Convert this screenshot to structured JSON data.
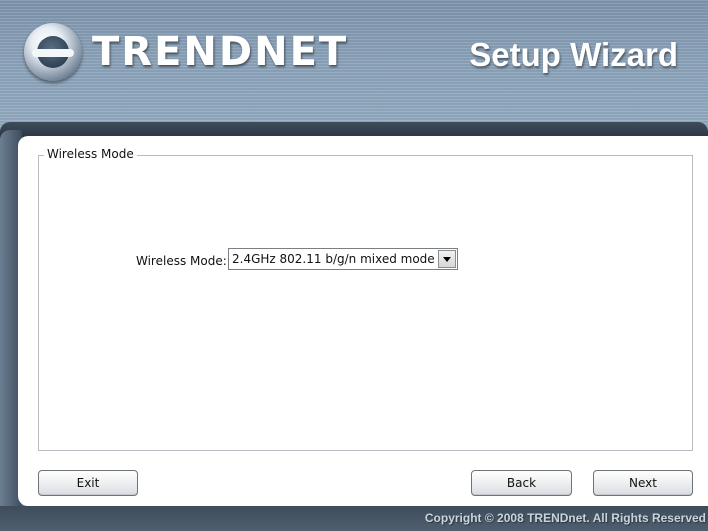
{
  "header": {
    "brand": "TRENDNET",
    "title": "Setup Wizard",
    "logo_icon": "trendnet-globe-logo-icon"
  },
  "section": {
    "legend": "Wireless Mode",
    "wireless_mode_label": "Wireless Mode:",
    "wireless_mode_value": "2.4GHz 802.11 b/g/n mixed mode",
    "dropdown_icon": "chevron-down-icon"
  },
  "buttons": {
    "exit": "Exit",
    "back": "Back",
    "next": "Next"
  },
  "footer": {
    "copyright": "Copyright © 2008 TRENDnet. All Rights Reserved"
  },
  "colors": {
    "header": "#8aa2b9",
    "band": "#2a3642",
    "panel": "#ffffff"
  }
}
